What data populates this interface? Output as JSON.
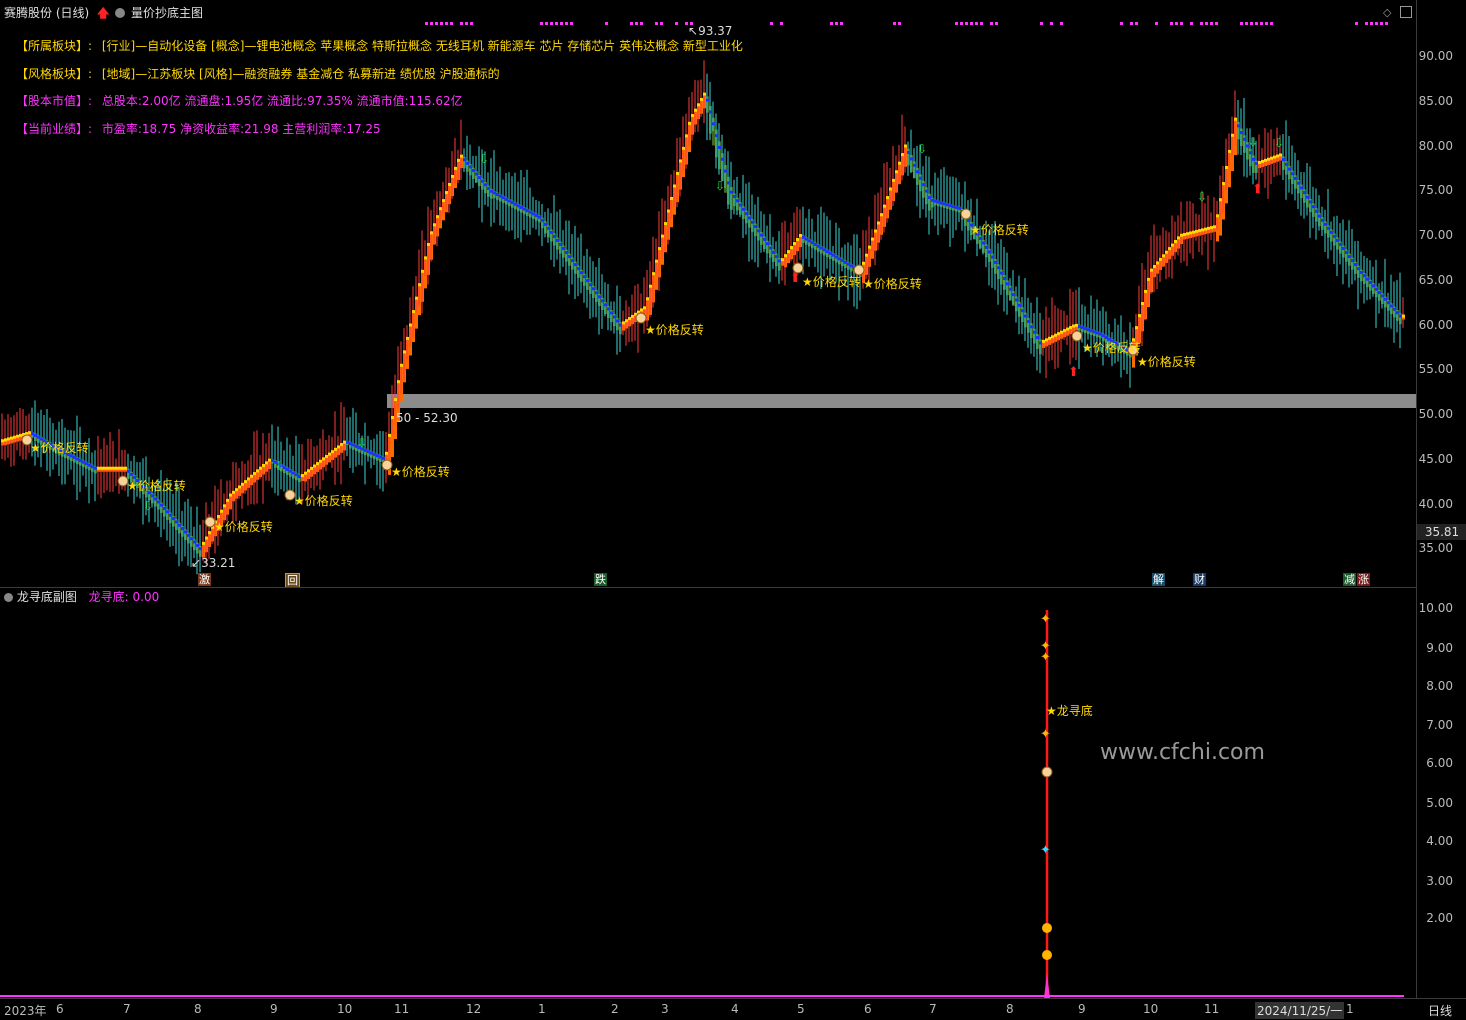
{
  "header": {
    "stock_name": "赛腾股份",
    "period": "(日线)",
    "indicator_name": "量价抄底主图",
    "up_arrow": "arrow-up-icon",
    "settings": "gear-icon"
  },
  "info": {
    "sector_label": "【所属板块】:",
    "sector_value": "[行业]—自动化设备 [概念]—锂电池概念 苹果概念 特斯拉概念 无线耳机 新能源车 芯片 存储芯片 英伟达概念 新型工业化",
    "style_label": "【风格板块】:",
    "style_value": "[地域]—江苏板块 [风格]—融资融券 基金减仓 私募新进 绩优股 沪股通标的",
    "capital_label": "【股本市值】:",
    "capital_value": "总股本:2.00亿 流通盘:1.95亿 流通比:97.35% 流通市值:115.62亿",
    "perf_label": "【当前业绩】:",
    "perf_value": "市盈率:18.75 净资收益率:21.98 主营利润率:17.25"
  },
  "main_axis": [
    "90.00",
    "85.00",
    "80.00",
    "75.00",
    "70.00",
    "65.00",
    "60.00",
    "55.00",
    "50.00",
    "45.00",
    "40.00",
    "35.00"
  ],
  "current_price_tag": "35.81",
  "annotations": {
    "high": "93.37",
    "low": "33.21",
    "support_band": "50 - 52.30",
    "signal_text": "★价格反转"
  },
  "events": [
    "激",
    "回",
    "跌",
    "解",
    "财",
    "减",
    "涨"
  ],
  "sub": {
    "title": "龙寻底副图",
    "value_label": "龙寻底: 0.00",
    "signal_text": "★龙寻底",
    "axis": [
      "10.00",
      "9.00",
      "8.00",
      "7.00",
      "6.00",
      "5.00",
      "4.00",
      "3.00",
      "2.00"
    ]
  },
  "watermark": "www.cfchi.com",
  "time_axis": {
    "labels": [
      "2023年",
      "6",
      "7",
      "8",
      "9",
      "10",
      "11",
      "12",
      "1",
      "2",
      "3",
      "4",
      "5",
      "6",
      "7",
      "8",
      "9",
      "10",
      "11",
      "2024/11/25/一",
      "1"
    ],
    "period_button": "日线"
  },
  "colors": {
    "up": "#ff3b3b",
    "down": "#3ad6d6",
    "rise_band": "#ff6a00",
    "fall_band": "#3d6b1a",
    "line_yellow": "#ffd800",
    "line_blue": "#1f2fff",
    "magenta": "#ff33ff",
    "support": "#8c8c8c"
  }
}
